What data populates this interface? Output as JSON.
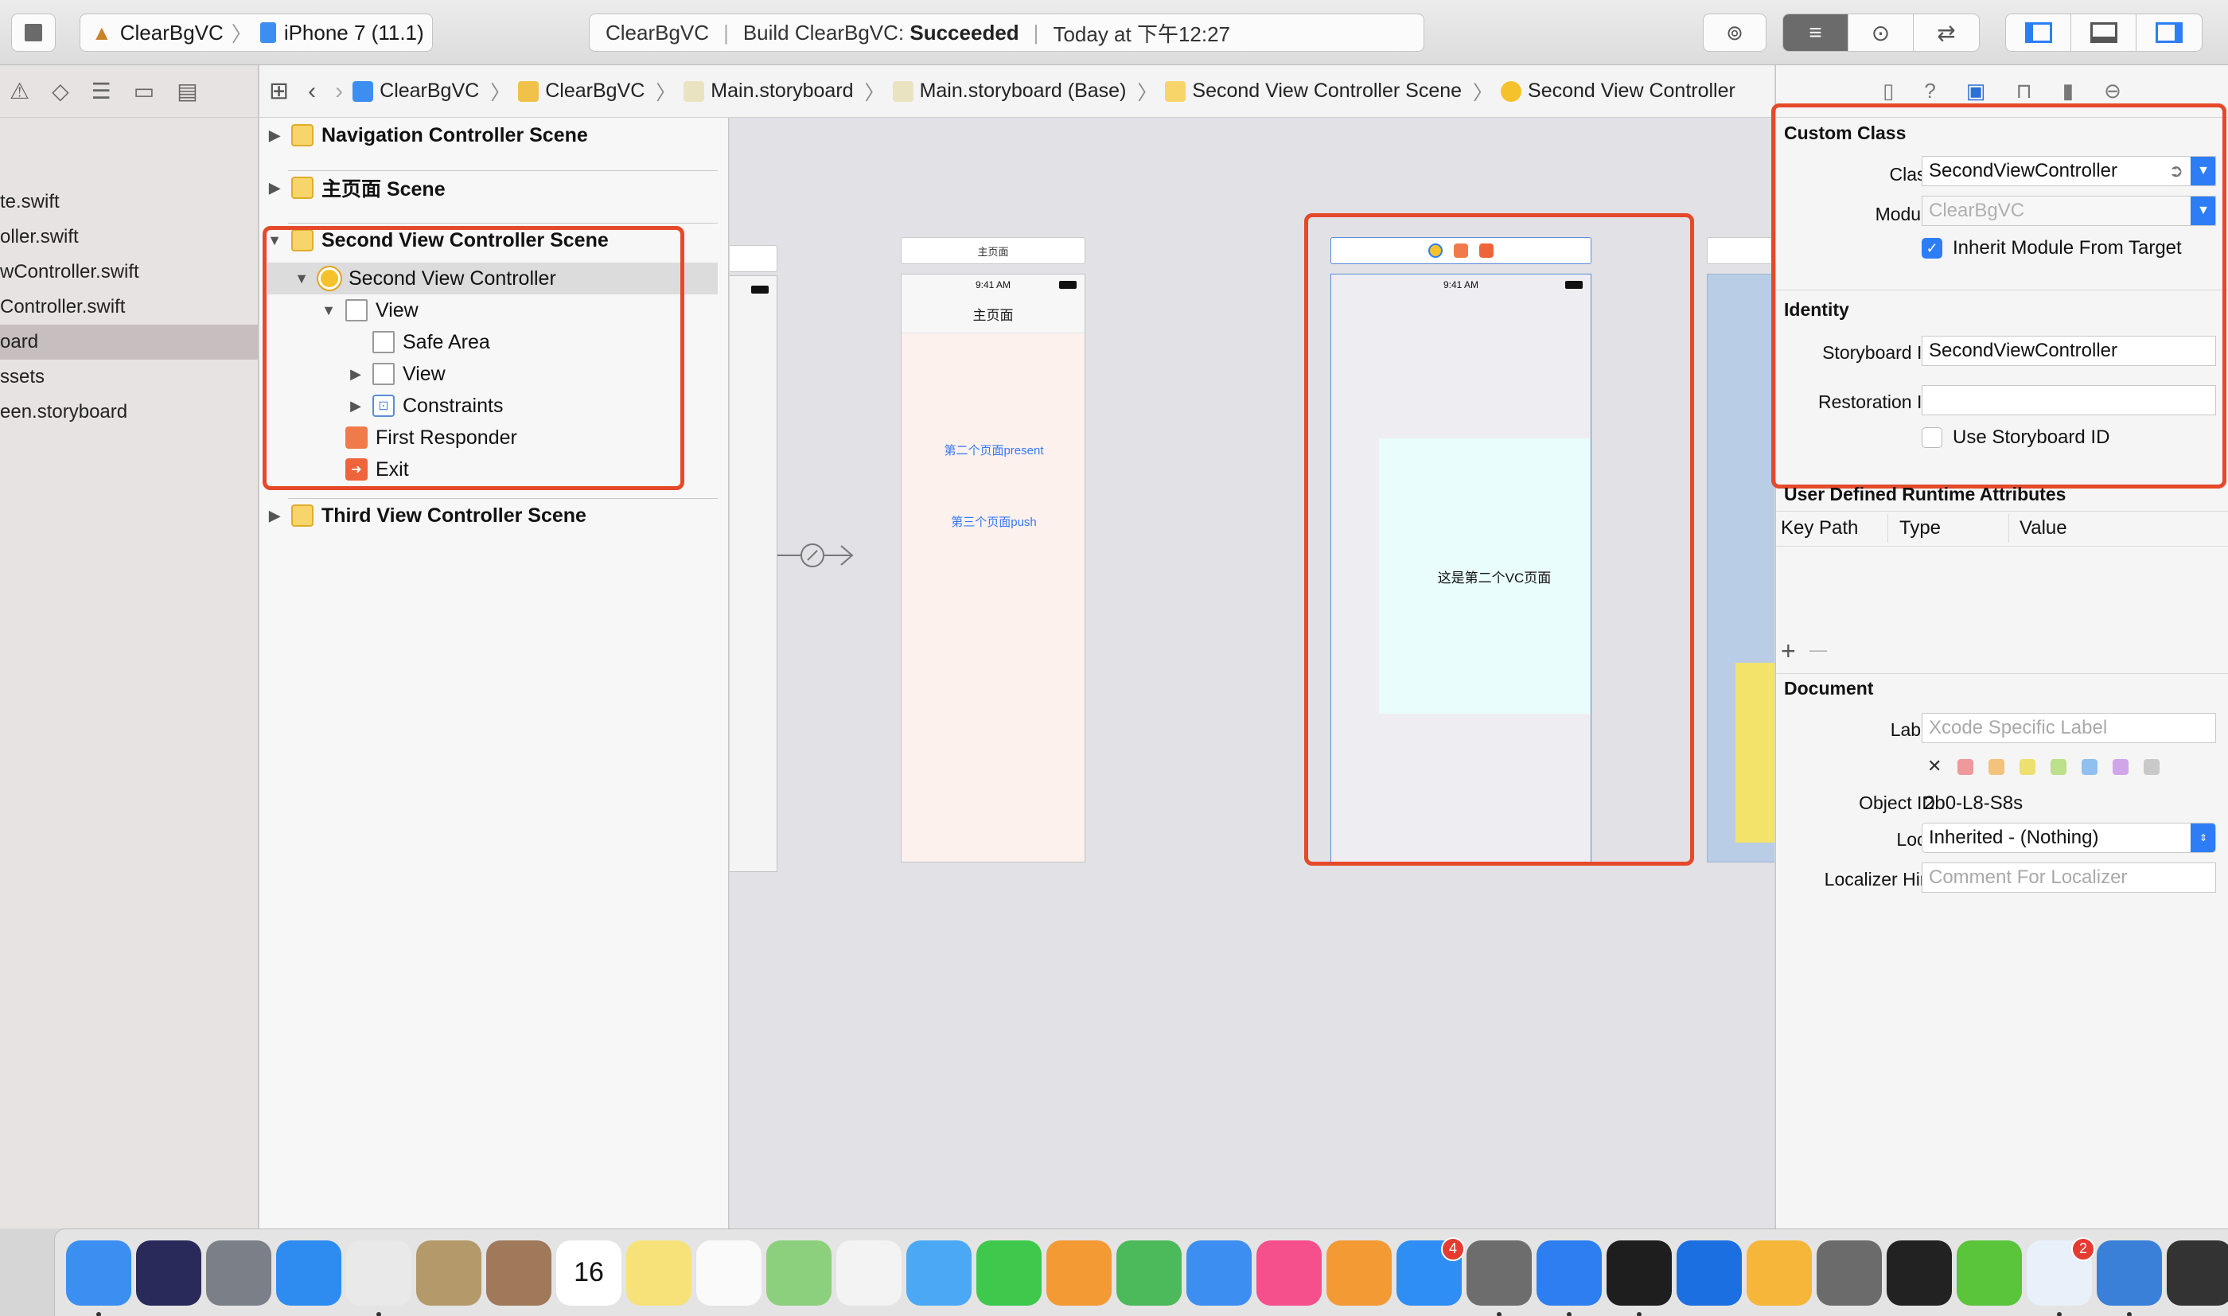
{
  "toolbar": {
    "scheme_name": "ClearBgVC",
    "scheme_sep": "〉",
    "device": "iPhone 7 (11.1)",
    "activity_project": "ClearBgVC",
    "activity_action": "Build ClearBgVC:",
    "activity_status": "Succeeded",
    "activity_time": "Today at 下午12:27"
  },
  "navigator": {
    "files": [
      {
        "label": "te.swift"
      },
      {
        "label": "oller.swift"
      },
      {
        "label": "wController.swift"
      },
      {
        "label": "Controller.swift"
      },
      {
        "label": "oard",
        "selected": true
      },
      {
        "label": "ssets"
      },
      {
        "label": "een.storyboard"
      }
    ]
  },
  "jumpbar": {
    "crumbs": [
      "ClearBgVC",
      "ClearBgVC",
      "Main.storyboard",
      "Main.storyboard (Base)",
      "Second View Controller Scene",
      "Second View Controller"
    ],
    "separator": "〉"
  },
  "outline": {
    "nav_scene": "Navigation Controller Scene",
    "main_scene": "主页面 Scene",
    "second_scene": "Second View Controller Scene",
    "second_vc": "Second View Controller",
    "view": "View",
    "safe_area": "Safe Area",
    "subview": "View",
    "constraints": "Constraints",
    "first_responder": "First Responder",
    "exit": "Exit",
    "third_scene": "Third View Controller Scene"
  },
  "canvas": {
    "main_scene_title": "主页面",
    "status_time": "9:41 AM",
    "main_nav_title": "主页面",
    "link_present": "第二个页面present",
    "link_push": "第三个页面push",
    "second_label": "这是第二个VC页面",
    "second_status_time": "9:41 AM",
    "colors": {
      "main_bg": "#fdf1ee",
      "second_bg": "#eafdfd",
      "link": "#3478f6",
      "highlight": "#e5492a"
    }
  },
  "inspector": {
    "custom_class_title": "Custom Class",
    "class_label": "Class",
    "class_value": "SecondViewController",
    "module_label": "Module",
    "module_placeholder": "ClearBgVC",
    "inherit_label": "Inherit Module From Target",
    "inherit_checked": true,
    "identity_title": "Identity",
    "storyboard_id_label": "Storyboard ID",
    "storyboard_id_value": "SecondViewController",
    "restoration_id_label": "Restoration ID",
    "restoration_id_value": "",
    "use_storyboard_id_label": "Use Storyboard ID",
    "use_storyboard_id_checked": false,
    "runtime_attrs_title": "User Defined Runtime Attributes",
    "col_key_path": "Key Path",
    "col_type": "Type",
    "col_value": "Value",
    "add_symbol": "+",
    "remove_symbol": "—",
    "document_title": "Document",
    "doc_label_label": "Label",
    "doc_label_placeholder": "Xcode Specific Label",
    "object_id_label": "Object ID",
    "object_id_value": "2b0-L8-S8s",
    "lock_label": "Lock",
    "lock_value": "Inherited - (Nothing)",
    "localizer_label": "Localizer Hint",
    "localizer_placeholder": "Comment For Localizer",
    "label_colors": [
      "#ee9a9a",
      "#f3c27c",
      "#ece06f",
      "#bde08a",
      "#8fc0f0",
      "#d1a6e8",
      "#c9c9c9"
    ]
  },
  "dock": {
    "apps": [
      {
        "name": "finder-icon",
        "color": "#3b8ff0"
      },
      {
        "name": "siri-icon",
        "color": "#2a2a5a"
      },
      {
        "name": "launchpad-icon",
        "color": "#7a7f88"
      },
      {
        "name": "safari-icon",
        "color": "#2e8cf0"
      },
      {
        "name": "chrome-icon",
        "color": "#e9e9e9"
      },
      {
        "name": "mail-bird-icon",
        "color": "#b49a6a"
      },
      {
        "name": "contacts-icon",
        "color": "#a0785a"
      },
      {
        "name": "calendar-icon",
        "color": "#ffffff",
        "text": "16"
      },
      {
        "name": "notes-icon",
        "color": "#f7e27a"
      },
      {
        "name": "reminders-icon",
        "color": "#fafafa"
      },
      {
        "name": "maps-icon",
        "color": "#8ccf7c"
      },
      {
        "name": "photos-icon",
        "color": "#f3f3f3"
      },
      {
        "name": "messages-icon",
        "color": "#4aa8f5"
      },
      {
        "name": "facetime-icon",
        "color": "#3ec94c"
      },
      {
        "name": "pages-icon",
        "color": "#f39a35"
      },
      {
        "name": "numbers-icon",
        "color": "#4cb95b"
      },
      {
        "name": "keynote-icon",
        "color": "#3c8ef0"
      },
      {
        "name": "itunes-icon",
        "color": "#f54f8c"
      },
      {
        "name": "ibooks-icon",
        "color": "#f39a35"
      },
      {
        "name": "app-store-icon",
        "color": "#2e8ef3",
        "badge": "4"
      },
      {
        "name": "system-preferences-icon",
        "color": "#6d6d6d"
      },
      {
        "name": "xcode-icon",
        "color": "#2d7ef0"
      },
      {
        "name": "terminal-icon",
        "color": "#1e1e1e"
      },
      {
        "name": "location-app-icon",
        "color": "#1b6fe0"
      },
      {
        "name": "sketch-icon",
        "color": "#f6b63a"
      },
      {
        "name": "calculator-icon",
        "color": "#6b6b6b"
      },
      {
        "name": "qq-icon",
        "color": "#222222"
      },
      {
        "name": "wechat-icon",
        "color": "#5ac43b"
      },
      {
        "name": "task-icon",
        "color": "#e8f0fa",
        "badge": "2"
      },
      {
        "name": "simulator-icon",
        "color": "#3a7fd8"
      },
      {
        "name": "phone-device-icon",
        "color": "#333333"
      }
    ]
  }
}
